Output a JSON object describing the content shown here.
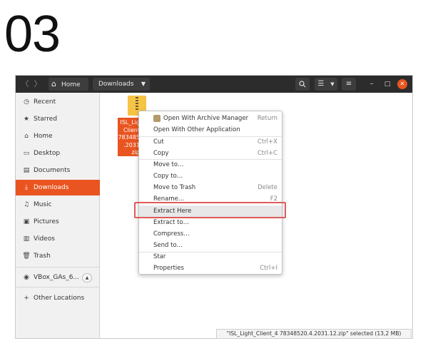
{
  "step_number": "03",
  "header": {
    "back_glyph": "〈",
    "forward_glyph": "〉",
    "home_label": "Home",
    "downloads_label": "Downloads",
    "icons": {
      "back": "chevron-left-icon",
      "forward": "chevron-right-icon",
      "home": "home-icon",
      "search": "search-icon",
      "list_view": "list-view-icon",
      "menu": "hamburger-menu-icon",
      "minimize": "minimize-icon",
      "maximize": "maximize-icon",
      "close": "close-icon"
    },
    "close_color": "#e95420"
  },
  "sidebar": {
    "items": [
      {
        "label": "Recent",
        "icon": "clock-icon"
      },
      {
        "label": "Starred",
        "icon": "star-icon"
      },
      {
        "label": "Home",
        "icon": "home-icon"
      },
      {
        "label": "Desktop",
        "icon": "desktop-icon"
      },
      {
        "label": "Documents",
        "icon": "document-icon"
      },
      {
        "label": "Downloads",
        "icon": "download-icon",
        "active": true
      },
      {
        "label": "Music",
        "icon": "music-icon"
      },
      {
        "label": "Pictures",
        "icon": "picture-icon"
      },
      {
        "label": "Videos",
        "icon": "video-icon"
      },
      {
        "label": "Trash",
        "icon": "trash-icon"
      }
    ],
    "device": {
      "label": "VBox_GAs_6...",
      "icon": "disc-icon",
      "eject_icon": "eject-icon"
    },
    "other_locations": {
      "label": "Other Locations",
      "icon": "plus-icon"
    },
    "accent_color": "#e95420"
  },
  "file": {
    "label_lines": [
      "ISL_Lig",
      "Client",
      "783485",
      ".2031",
      "zip"
    ],
    "icon": "zip-archive-icon"
  },
  "context_menu": {
    "items": [
      {
        "label": "Open With Archive Manager",
        "shortcut": "Return"
      },
      {
        "label": "Open With Other Application",
        "shortcut": ""
      },
      {
        "label": "Cut",
        "shortcut": "Ctrl+X"
      },
      {
        "label": "Copy",
        "shortcut": "Ctrl+C"
      },
      {
        "label": "Move to…",
        "shortcut": ""
      },
      {
        "label": "Copy to…",
        "shortcut": ""
      },
      {
        "label": "Move to Trash",
        "shortcut": "Delete"
      },
      {
        "label": "Rename…",
        "shortcut": "F2"
      },
      {
        "label": "Extract Here",
        "shortcut": "",
        "highlighted": true
      },
      {
        "label": "Extract to…",
        "shortcut": ""
      },
      {
        "label": "Compress…",
        "shortcut": ""
      },
      {
        "label": "Send to…",
        "shortcut": ""
      },
      {
        "label": "Star",
        "shortcut": ""
      },
      {
        "label": "Properties",
        "shortcut": "Ctrl+I"
      }
    ],
    "highlight_color": "#e05a5a"
  },
  "statusbar": {
    "text": "\"ISL_Light_Client_4 78348520.4.2031.12.zip\" selected (13,2 MB)"
  }
}
